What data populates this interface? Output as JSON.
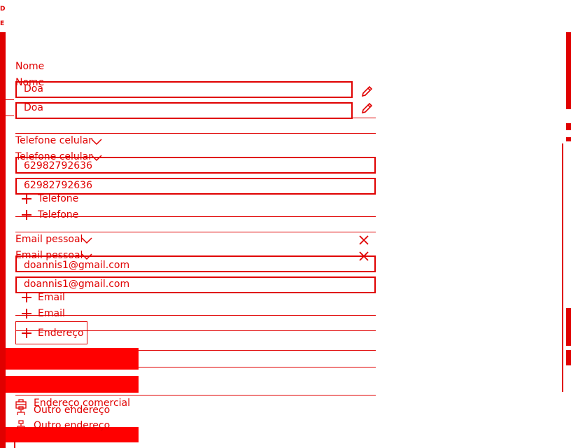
{
  "edge_left": {
    "letters": [
      "D",
      "E",
      "d"
    ]
  },
  "name_section": {
    "label": "Nome",
    "label_ghost": "Nome",
    "value": "Doa",
    "value_ghost": "Doa"
  },
  "phone_section": {
    "type_label": "Telefone celular",
    "type_label_ghost": "Telefone celular",
    "value": "62982792636",
    "value_ghost": "62982792636",
    "add_label": "Telefone",
    "add_label_ghost": "Telefone"
  },
  "email_section": {
    "type_label": "Email pessoal",
    "type_label_ghost": "Email pessoal",
    "value": "doannis1@gmail.com",
    "value_ghost": "doannis1@gmail.com",
    "add_label": "Email",
    "add_label_ghost": "Email"
  },
  "address_section": {
    "add_label": "Endereço",
    "menu_items": [
      {
        "label": "Endereço comercial",
        "icon": "briefcase-icon"
      },
      {
        "label": "Outro endereço",
        "icon": "network-icon"
      },
      {
        "label": "Outro endereço",
        "icon": "network-icon"
      }
    ]
  },
  "colors": {
    "accent": "#e00000",
    "block": "#ff0000",
    "background": "#ffffff"
  }
}
